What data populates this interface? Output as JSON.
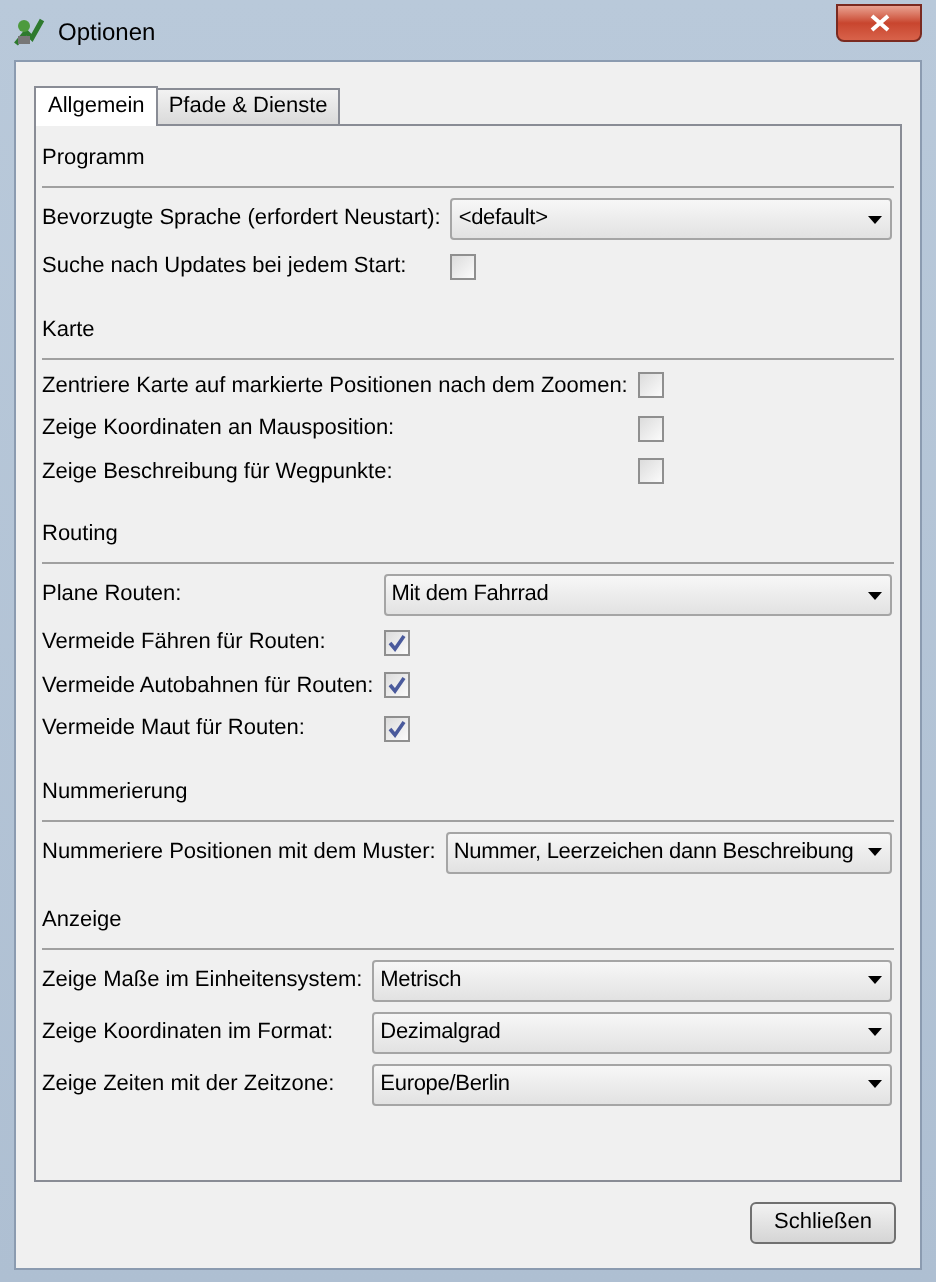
{
  "window": {
    "title": "Optionen"
  },
  "tabs": [
    {
      "label": "Allgemein",
      "selected": true
    },
    {
      "label": "Pfade & Dienste",
      "selected": false
    }
  ],
  "sections": [
    {
      "title": "Programm",
      "rows": [
        {
          "kind": "select",
          "label": "Bevorzugte Sprache (erfordert Neustart):",
          "value": "<default>"
        },
        {
          "kind": "checkbox",
          "label": "Suche nach Updates bei jedem Start:",
          "checked": false
        }
      ]
    },
    {
      "title": "Karte",
      "rows": [
        {
          "kind": "checkbox",
          "label": "Zentriere Karte auf markierte Positionen nach dem Zoomen:",
          "checked": false
        },
        {
          "kind": "checkbox",
          "label": "Zeige Koordinaten an Mausposition:",
          "checked": false
        },
        {
          "kind": "checkbox",
          "label": "Zeige Beschreibung für Wegpunkte:",
          "checked": false
        }
      ]
    },
    {
      "title": "Routing",
      "rows": [
        {
          "kind": "select",
          "label": "Plane Routen:",
          "value": "Mit dem Fahrrad"
        },
        {
          "kind": "checkbox",
          "label": "Vermeide Fähren für Routen:",
          "checked": true
        },
        {
          "kind": "checkbox",
          "label": "Vermeide Autobahnen für Routen:",
          "checked": true
        },
        {
          "kind": "checkbox",
          "label": "Vermeide Maut für Routen:",
          "checked": true
        }
      ]
    },
    {
      "title": "Nummerierung",
      "rows": [
        {
          "kind": "select",
          "label": "Nummeriere Positionen mit dem Muster:",
          "value": "Nummer, Leerzeichen dann Beschreibung"
        }
      ]
    },
    {
      "title": "Anzeige",
      "rows": [
        {
          "kind": "select",
          "label": "Zeige Maße im Einheitensystem:",
          "value": "Metrisch"
        },
        {
          "kind": "select",
          "label": "Zeige Koordinaten im Format:",
          "value": "Dezimalgrad"
        },
        {
          "kind": "select",
          "label": "Zeige Zeiten mit der Zeitzone:",
          "value": "Europe/Berlin"
        }
      ]
    }
  ],
  "buttons": [
    {
      "label": "Schließen"
    }
  ]
}
